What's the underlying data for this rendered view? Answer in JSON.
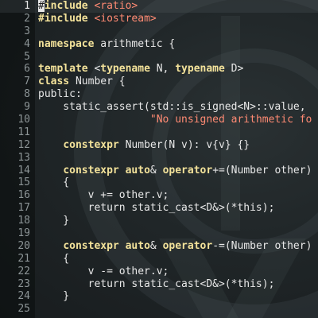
{
  "editor": {
    "current_line": 1,
    "lines": [
      {
        "n": "1",
        "tokens": [
          {
            "t": "#",
            "c": "cursor"
          },
          {
            "t": "include",
            "c": "pp"
          },
          {
            "t": " "
          },
          {
            "t": "<ratio>",
            "c": "inc"
          }
        ]
      },
      {
        "n": "2",
        "tokens": [
          {
            "t": "#include",
            "c": "pp"
          },
          {
            "t": " "
          },
          {
            "t": "<iostream>",
            "c": "inc"
          }
        ]
      },
      {
        "n": "3",
        "tokens": []
      },
      {
        "n": "4",
        "tokens": [
          {
            "t": "namespace",
            "c": "kw"
          },
          {
            "t": " arithmetic {"
          }
        ]
      },
      {
        "n": "5",
        "tokens": []
      },
      {
        "n": "6",
        "tokens": [
          {
            "t": "template",
            "c": "kw"
          },
          {
            "t": " <"
          },
          {
            "t": "typename",
            "c": "kw"
          },
          {
            "t": " N, "
          },
          {
            "t": "typename",
            "c": "kw"
          },
          {
            "t": " D>"
          }
        ]
      },
      {
        "n": "7",
        "tokens": [
          {
            "t": "class",
            "c": "kw"
          },
          {
            "t": " Number {"
          }
        ]
      },
      {
        "n": "8",
        "tokens": [
          {
            "t": "public:"
          }
        ]
      },
      {
        "n": "9",
        "tokens": [
          {
            "t": "    static_assert(std::is_signed<N>::value,"
          }
        ]
      },
      {
        "n": "10",
        "tokens": [
          {
            "t": "                  "
          },
          {
            "t": "\"No unsigned arithmetic fo",
            "c": "str"
          }
        ]
      },
      {
        "n": "11",
        "tokens": []
      },
      {
        "n": "12",
        "tokens": [
          {
            "t": "    "
          },
          {
            "t": "constexpr",
            "c": "kw"
          },
          {
            "t": " Number(N v): v{v} {}"
          }
        ]
      },
      {
        "n": "13",
        "tokens": []
      },
      {
        "n": "14",
        "tokens": [
          {
            "t": "    "
          },
          {
            "t": "constexpr",
            "c": "kw"
          },
          {
            "t": " "
          },
          {
            "t": "auto",
            "c": "kw"
          },
          {
            "t": "& "
          },
          {
            "t": "operator",
            "c": "kw"
          },
          {
            "t": "+=(Number other)"
          }
        ]
      },
      {
        "n": "15",
        "tokens": [
          {
            "t": "    {"
          }
        ]
      },
      {
        "n": "16",
        "tokens": [
          {
            "t": "        v += other.v;"
          }
        ]
      },
      {
        "n": "17",
        "tokens": [
          {
            "t": "        return static_cast<D&>(*this);"
          }
        ]
      },
      {
        "n": "18",
        "tokens": [
          {
            "t": "    }"
          }
        ]
      },
      {
        "n": "19",
        "tokens": []
      },
      {
        "n": "20",
        "tokens": [
          {
            "t": "    "
          },
          {
            "t": "constexpr",
            "c": "kw"
          },
          {
            "t": " "
          },
          {
            "t": "auto",
            "c": "kw"
          },
          {
            "t": "& "
          },
          {
            "t": "operator",
            "c": "kw"
          },
          {
            "t": "-=(Number other)"
          }
        ]
      },
      {
        "n": "21",
        "tokens": [
          {
            "t": "    {"
          }
        ]
      },
      {
        "n": "22",
        "tokens": [
          {
            "t": "        v -= other.v;"
          }
        ]
      },
      {
        "n": "23",
        "tokens": [
          {
            "t": "        return static_cast<D&>(*this);"
          }
        ]
      },
      {
        "n": "24",
        "tokens": [
          {
            "t": "    }"
          }
        ]
      },
      {
        "n": "25",
        "tokens": []
      }
    ]
  }
}
